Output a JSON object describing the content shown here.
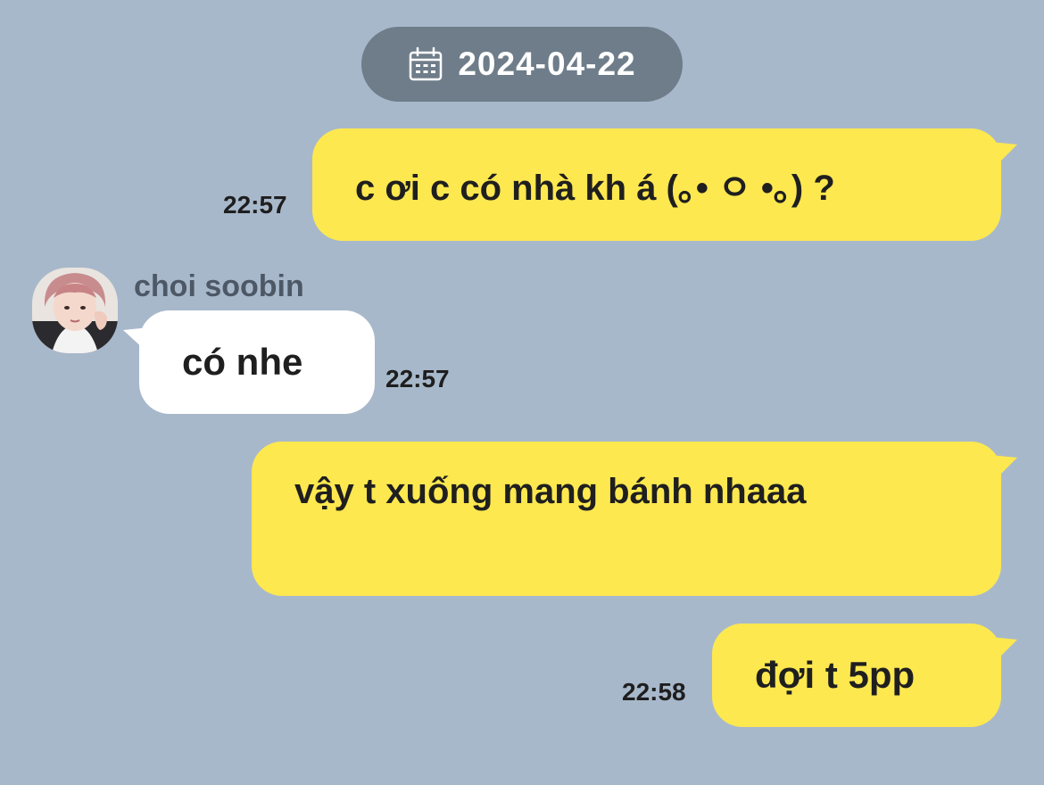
{
  "date_divider": {
    "label": "2024-04-22",
    "icon": "calendar-icon"
  },
  "sender": {
    "name": "choi soobin",
    "avatar": "avatar"
  },
  "messages": [
    {
      "side": "outgoing",
      "text": "c ơi c có nhà kh á (｡• ㅇ •｡) ?",
      "time": "22:57"
    },
    {
      "side": "incoming",
      "text": "có nhe",
      "time": "22:57"
    },
    {
      "side": "outgoing",
      "text": "vậy t xuống mang bánh nhaaa",
      "time": ""
    },
    {
      "side": "outgoing",
      "text": "đợi t 5pp",
      "time": "22:58"
    }
  ],
  "colors": {
    "background": "#a8b8cb",
    "outgoing_bubble": "#fde84f",
    "incoming_bubble": "#ffffff",
    "date_pill": "#6f7d8a",
    "sender_name": "#4d5866"
  }
}
